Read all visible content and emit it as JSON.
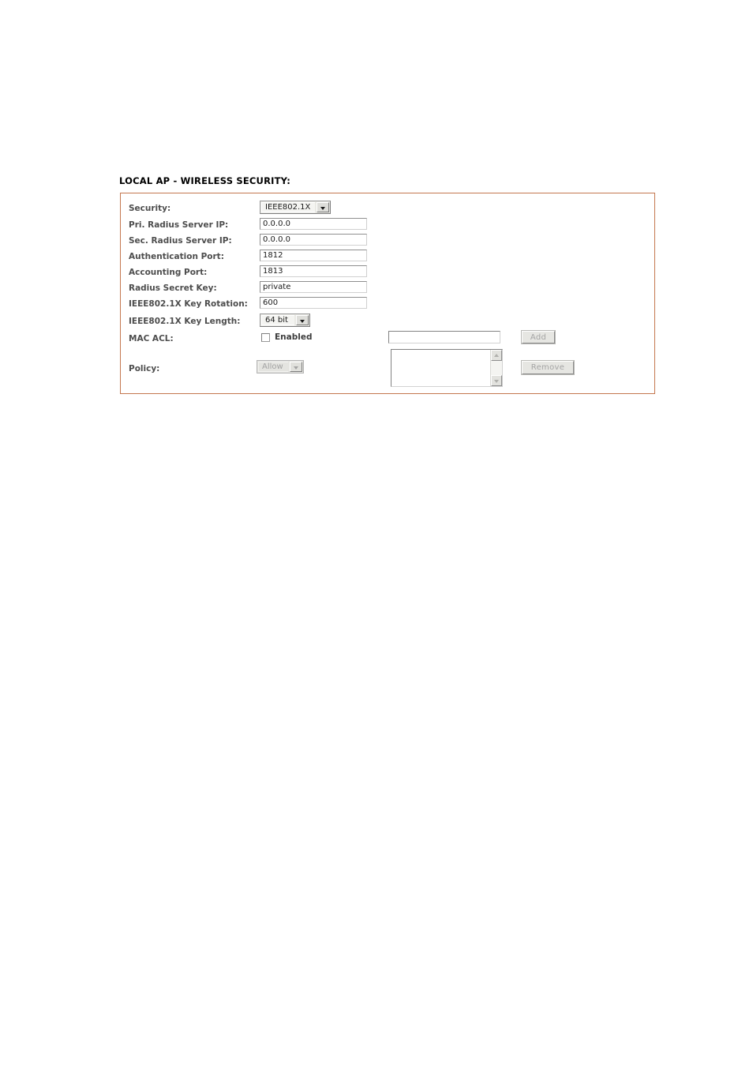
{
  "section": {
    "title": "LOCAL AP - WIRELESS SECURITY:",
    "border_color": "#c4774f"
  },
  "form": {
    "rows": [
      {
        "label": "Security:",
        "control": "select",
        "value": "IEEE802.1X"
      },
      {
        "label": "Pri. Radius Server IP:",
        "control": "textbox",
        "value": "0.0.0.0"
      },
      {
        "label": "Sec. Radius Server IP:",
        "control": "textbox",
        "value": "0.0.0.0"
      },
      {
        "label": "Authentication Port:",
        "control": "textbox",
        "value": "1812"
      },
      {
        "label": "Accounting Port:",
        "control": "textbox",
        "value": "1813"
      },
      {
        "label": "Radius Secret Key:",
        "control": "textbox",
        "value": "private"
      },
      {
        "label": "IEEE802.1X Key Rotation:",
        "control": "textbox",
        "value": "600"
      },
      {
        "label": "IEEE802.1X Key Length:",
        "control": "select",
        "value": "64 bit"
      },
      {
        "label": "MAC ACL:",
        "control": "checkbox",
        "value": "Enabled"
      },
      {
        "label": "Policy:",
        "control": "select",
        "value": "Allow"
      }
    ],
    "security": {
      "label": "Security:",
      "value": "IEEE802.1X"
    },
    "pri_radius_ip": {
      "label": "Pri. Radius Server IP:",
      "value": "0.0.0.0",
      "placeholder": ""
    },
    "sec_radius_ip": {
      "label": "Sec. Radius Server IP:",
      "value": "0.0.0.0",
      "placeholder": ""
    },
    "auth_port": {
      "label": "Authentication Port:",
      "value": "1812",
      "placeholder": ""
    },
    "acct_port": {
      "label": "Accounting Port:",
      "value": "1813",
      "placeholder": ""
    },
    "secret_key": {
      "label": "Radius Secret Key:",
      "value": "private",
      "placeholder": ""
    },
    "key_rotation": {
      "label": "IEEE802.1X Key Rotation:",
      "value": "600",
      "placeholder": ""
    },
    "key_length": {
      "label": "IEEE802.1X Key Length:",
      "value": "64 bit"
    },
    "mac_acl": {
      "label": "MAC ACL:",
      "checkbox_label": "Enabled",
      "checked": "false",
      "entry_value": "",
      "entry_placeholder": ""
    },
    "policy": {
      "label": "Policy:",
      "value": "Allow",
      "disabled": "true"
    },
    "buttons": {
      "add": "Add",
      "remove": "Remove"
    },
    "mac_list": {
      "items": [],
      "scroll_up_icon": "triangle-up-icon",
      "scroll_down_icon": "triangle-down-icon"
    }
  }
}
